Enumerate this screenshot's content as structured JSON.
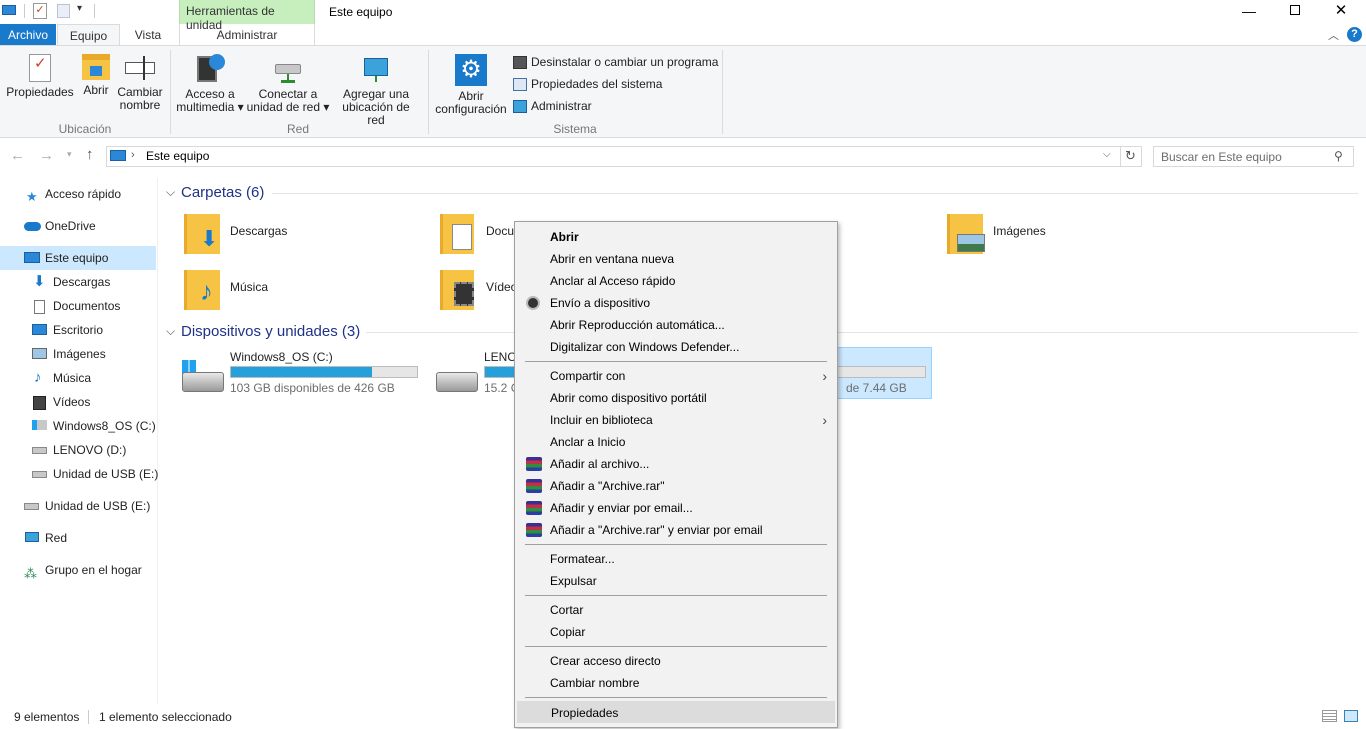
{
  "window": {
    "title": "Este equipo",
    "context_tab_group": "Herramientas de unidad",
    "context_tab": "Administrar"
  },
  "ribbon_tabs": [
    "Archivo",
    "Equipo",
    "Vista"
  ],
  "ribbon": {
    "ubicacion": {
      "label": "Ubicación",
      "buttons": [
        {
          "line1": "Propiedades",
          "line2": ""
        },
        {
          "line1": "Abrir",
          "line2": ""
        },
        {
          "line1": "Cambiar",
          "line2": "nombre"
        }
      ]
    },
    "red": {
      "label": "Red",
      "buttons": [
        {
          "line1": "Acceso a",
          "line2": "multimedia ▾"
        },
        {
          "line1": "Conectar a",
          "line2": "unidad de red ▾"
        },
        {
          "line1": "Agregar una",
          "line2": "ubicación de red"
        }
      ]
    },
    "sistema": {
      "label": "Sistema",
      "open_config": {
        "line1": "Abrir",
        "line2": "configuración"
      },
      "items": [
        "Desinstalar o cambiar un programa",
        "Propiedades del sistema",
        "Administrar"
      ]
    }
  },
  "address": {
    "path": "Este equipo",
    "search_placeholder": "Buscar en Este equipo"
  },
  "nav": [
    "Acceso rápido",
    "OneDrive",
    "Este equipo",
    "Descargas",
    "Documentos",
    "Escritorio",
    "Imágenes",
    "Música",
    "Vídeos",
    "Windows8_OS (C:)",
    "LENOVO (D:)",
    "Unidad de USB (E:)",
    "Unidad de USB (E:)",
    "Red",
    "Grupo en el hogar"
  ],
  "content": {
    "folders_header": "Carpetas (6)",
    "folders": [
      "Descargas",
      "Docu",
      "Imágenes",
      "Música",
      "Vídeo"
    ],
    "devices_header": "Dispositivos y unidades (3)",
    "drives": [
      {
        "name": "Windows8_OS (C:)",
        "free": "103 GB disponibles de 426 GB",
        "used_fraction": 0.76
      },
      {
        "name": "LENO",
        "free": "15.2 G",
        "used_fraction": 0.6
      },
      {
        "name": "",
        "free": "de 7.44 GB",
        "used_fraction": 0.0
      }
    ]
  },
  "context_menu": {
    "items": [
      "Abrir",
      "Abrir en ventana nueva",
      "Anclar al Acceso rápido",
      "Envío a dispositivo",
      "Abrir Reproducción automática...",
      "Digitalizar con Windows Defender...",
      "Compartir con",
      "Abrir como dispositivo portátil",
      "Incluir en biblioteca",
      "Anclar a Inicio",
      "Añadir al archivo...",
      "Añadir a \"Archive.rar\"",
      "Añadir y enviar por email...",
      "Añadir a \"Archive.rar\" y enviar por email",
      "Formatear...",
      "Expulsar",
      "Cortar",
      "Copiar",
      "Crear acceso directo",
      "Cambiar nombre",
      "Propiedades"
    ]
  },
  "status": {
    "count": "9 elementos",
    "selected": "1 elemento seleccionado"
  },
  "colors": {
    "accent": "#1979ca",
    "context_tab": "#c6efbd",
    "drive_fill": "#26a0da",
    "section_header": "#1e3287"
  }
}
